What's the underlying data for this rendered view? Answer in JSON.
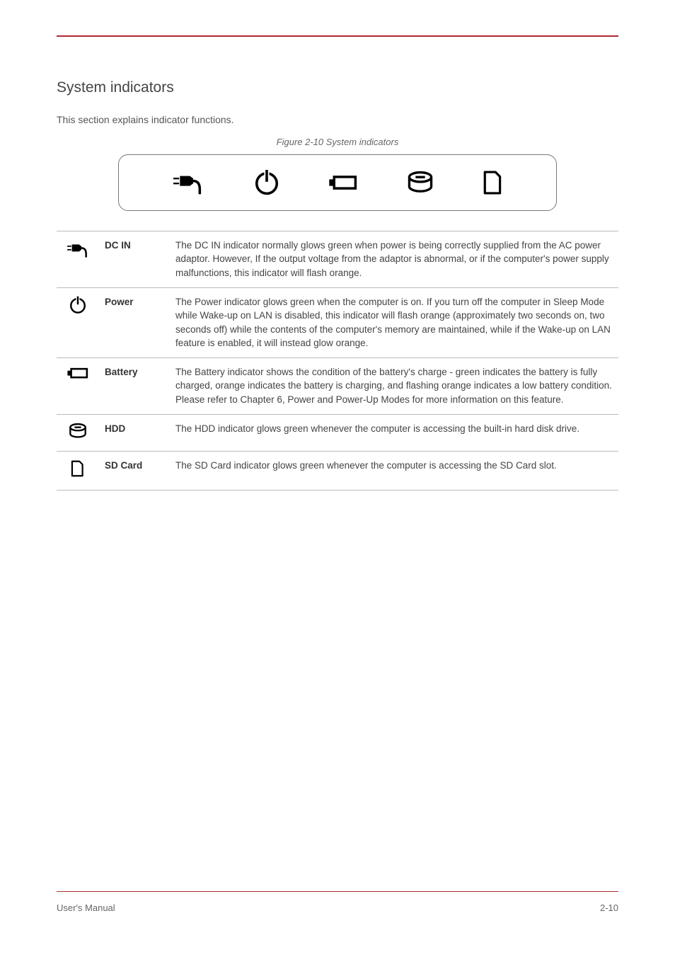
{
  "section_title": "System indicators",
  "intro": "This section explains indicator functions.",
  "figure_caption": "Figure 2-10 System indicators",
  "rows": [
    {
      "name": "DC IN",
      "desc": "The DC IN indicator normally glows green when power is being correctly supplied from the AC power adaptor. However, If the output voltage from the adaptor is abnormal, or if the computer's power supply malfunctions, this indicator will flash orange."
    },
    {
      "name": "Power",
      "desc": "The Power indicator glows green when the computer is on. If you turn off the computer in Sleep Mode while Wake-up on LAN is disabled, this indicator will flash orange (approximately two seconds on, two seconds off) while the contents of the computer's memory are maintained, while if the Wake-up on LAN feature is enabled, it will instead glow orange."
    },
    {
      "name": "Battery",
      "desc": "The Battery indicator shows the condition of the battery's charge - green indicates the battery is fully charged, orange indicates the battery is charging, and flashing orange indicates a low battery condition. Please refer to Chapter 6, Power and Power-Up Modes for more information on this feature."
    },
    {
      "name": "HDD",
      "desc": "The HDD indicator glows green whenever the computer is accessing the built-in hard disk drive."
    },
    {
      "name": "SD Card",
      "desc": "The SD Card indicator glows green whenever the computer is accessing the SD Card slot."
    }
  ],
  "footer_left": "User's Manual",
  "footer_right": "2-10"
}
